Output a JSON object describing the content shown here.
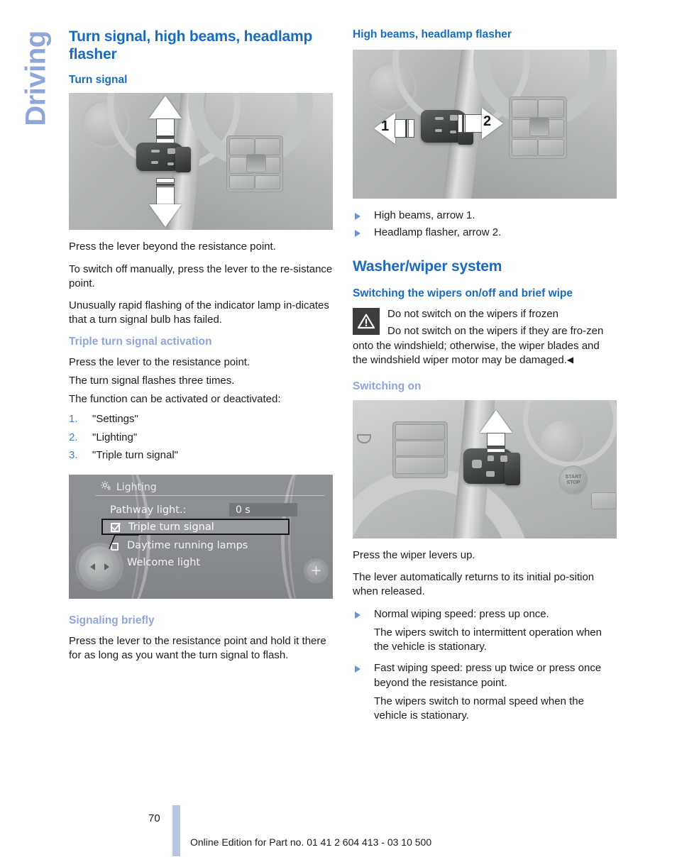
{
  "chapter_tab": "Driving",
  "left_column": {
    "section_title": "Turn signal, high beams, headlamp flasher",
    "sub_turn_signal": "Turn signal",
    "photo1": {
      "alt": "steering column turn signal lever with up and down arrows",
      "arrow_up_icon": "arrow-up-icon",
      "arrow_down_icon": "arrow-down-icon"
    },
    "p1": "Press the lever beyond the resistance point.",
    "p2": "To switch off manually, press the lever to the re-sistance point.",
    "p3": "Unusually rapid flashing of the indicator lamp in-dicates that a turn signal bulb has failed.",
    "sub_triple": "Triple turn signal activation",
    "p4": "Press the lever to the resistance point.",
    "p5": "The turn signal flashes three times.",
    "p6": "The function can be activated or deactivated:",
    "steps": [
      {
        "num": "1.",
        "label": "\"Settings\""
      },
      {
        "num": "2.",
        "label": "\"Lighting\""
      },
      {
        "num": "3.",
        "label": "\"Triple turn signal\""
      }
    ],
    "idrive": {
      "gear_icon": "gear-icon",
      "title": "Lighting",
      "row_pathway_label": "Pathway light.:",
      "row_pathway_value": "0 s",
      "selected_option": "Triple turn signal",
      "options": [
        "Daytime running lamps",
        "Welcome light"
      ],
      "controller_icon": "controller-left-right-icon",
      "plus_icon": "plus-icon"
    },
    "sub_signaling": "Signaling briefly",
    "p7": "Press the lever to the resistance point and hold it there for as long as you want the turn signal to flash."
  },
  "right_column": {
    "sub_high_beams": "High beams, headlamp flasher",
    "photo2": {
      "alt": "steering column lever with left arrow 1 and right arrow 2",
      "arrow_left_label": "1",
      "arrow_right_label": "2"
    },
    "bullets_high_beams": [
      "High beams, arrow 1.",
      "Headlamp flasher, arrow 2."
    ],
    "section_title": "Washer/wiper system",
    "sub_switching": "Switching the wipers on/off and brief wipe",
    "warning": {
      "icon": "warning-triangle-icon",
      "title": "Do not switch on the wipers if frozen",
      "body": "Do not switch on the wipers if they are fro-zen onto the windshield; otherwise, the wiper blades and the windshield wiper motor may be damaged.",
      "end_marker": "◀"
    },
    "sub_switching_on": "Switching on",
    "photo3": {
      "alt": "wiper lever on steering column with up arrow",
      "arrow_up_icon": "arrow-up-icon"
    },
    "p1": "Press the wiper levers up.",
    "p2": "The lever automatically returns to its initial po-sition when released.",
    "bullets_wipers": [
      {
        "main": "Normal wiping speed: press up once.",
        "cont": "The wipers switch to intermittent operation when the vehicle is stationary."
      },
      {
        "main": "Fast wiping speed: press up twice or press once beyond the resistance point.",
        "cont": "The wipers switch to normal speed when the vehicle is stationary."
      }
    ]
  },
  "footer": {
    "page_number": "70",
    "edition": "Online Edition for Part no. 01 41 2 604 413 - 03 10 500"
  },
  "colors": {
    "heading_blue": "#1a6bbd",
    "subheading_light": "#8ea6d8",
    "bullet_blue": "#6f93cf",
    "step_number_blue": "#3d7fc7",
    "footer_bar": "#b9c6e4",
    "warning_box": "#3d3d3d"
  }
}
